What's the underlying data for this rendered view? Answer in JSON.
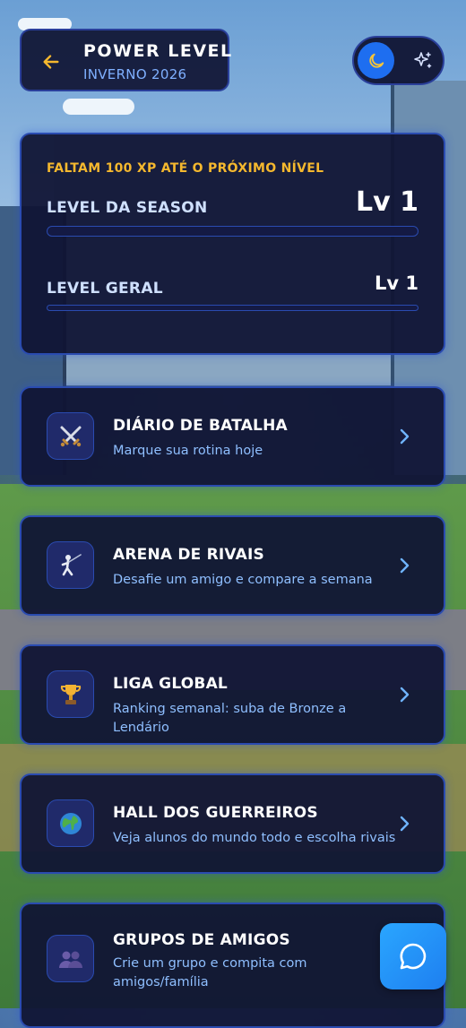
{
  "header": {
    "title": "POWER LEVEL",
    "subtitle": "INVERNO 2026"
  },
  "theme_toggle": {
    "active": "dark"
  },
  "progress": {
    "next_level_text": "FALTAM 100 XP ATÉ O PRÓXIMO NÍVEL",
    "season_label": "LEVEL DA SEASON",
    "season_value": "Lv 1",
    "season_progress": 0,
    "overall_label": "LEVEL GERAL",
    "overall_value": "Lv 1",
    "overall_progress": 0
  },
  "menu": [
    {
      "title": "DIÁRIO DE BATALHA",
      "subtitle": "Marque sua rotina hoje",
      "icon": "crossed-swords-icon"
    },
    {
      "title": "ARENA DE RIVAIS",
      "subtitle": "Desafie um amigo e compare a semana",
      "icon": "fencer-icon"
    },
    {
      "title": "LIGA GLOBAL",
      "subtitle": "Ranking semanal: suba de Bronze a Lendário",
      "icon": "trophy-icon"
    },
    {
      "title": "HALL DOS GUERREIROS",
      "subtitle": "Veja alunos do mundo todo e escolha rivais",
      "icon": "globe-icon"
    },
    {
      "title": "GRUPOS DE AMIGOS",
      "subtitle": "Crie um grupo e compita com amigos/família",
      "icon": "people-icon"
    }
  ],
  "colors": {
    "accent": "#f5b82e",
    "primary": "#1e6ef0",
    "card_bg": "#101434",
    "subtext": "#8fbfff"
  }
}
